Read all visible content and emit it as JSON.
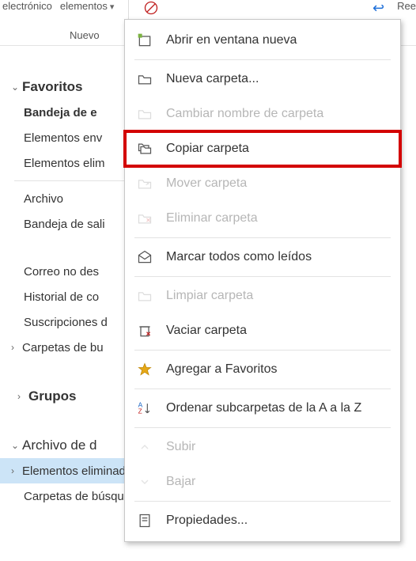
{
  "ribbon": {
    "item1": "electrónico",
    "item2": "elementos",
    "right_partial": "Ree",
    "nuevo": "Nuevo"
  },
  "sidebar": {
    "favoritos": {
      "label": "Favoritos",
      "items": [
        {
          "label": "Bandeja de e",
          "bold": true
        },
        {
          "label": "Elementos env"
        },
        {
          "label": "Elementos elim"
        }
      ]
    },
    "account": {
      "items": [
        {
          "label": "Archivo"
        },
        {
          "label": "Bandeja de sali"
        },
        {
          "label": ""
        },
        {
          "label": "Correo no des"
        },
        {
          "label": "Historial de co"
        },
        {
          "label": "Suscripciones d"
        }
      ],
      "carpetas_busqueda": {
        "label": "Carpetas de bu",
        "expandable": true
      }
    },
    "grupos": {
      "label": "Grupos"
    },
    "archivo": {
      "label": "Archivo de d",
      "items": [
        {
          "label": "Elementos eliminados",
          "count": "",
          "selected": true,
          "expandable": true
        },
        {
          "label": "Carpetas de búsqueda"
        }
      ]
    }
  },
  "ctx": {
    "abrir": "Abrir en ventana nueva",
    "nueva_carpeta": "Nueva carpeta...",
    "cambiar_nombre": "Cambiar nombre de carpeta",
    "copiar": "Copiar carpeta",
    "mover": "Mover carpeta",
    "eliminar": "Eliminar carpeta",
    "marcar": "Marcar todos como leídos",
    "limpiar": "Limpiar carpeta",
    "vaciar": "Vaciar carpeta",
    "favoritos": "Agregar a Favoritos",
    "ordenar": "Ordenar subcarpetas de la A a la Z",
    "subir": "Subir",
    "bajar": "Bajar",
    "propiedades": "Propiedades..."
  }
}
